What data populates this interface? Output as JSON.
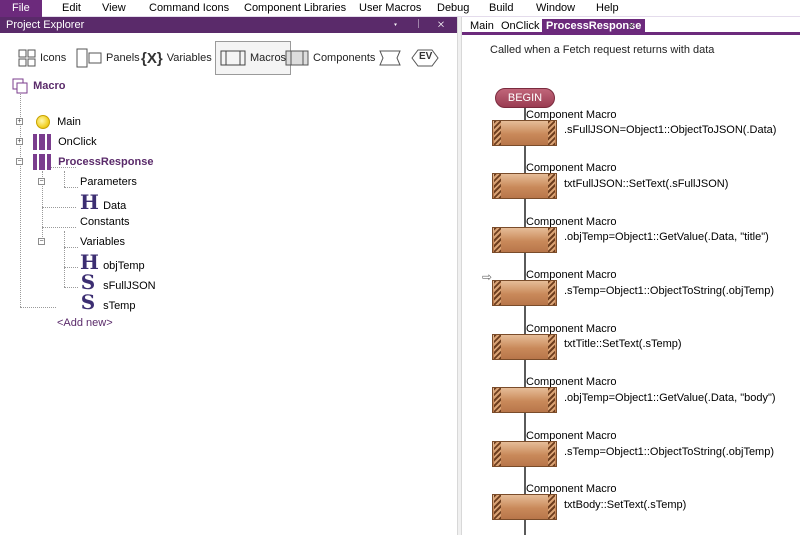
{
  "menu": [
    "File",
    "Edit",
    "View",
    "Command Icons",
    "Component Libraries",
    "User Macros",
    "Debug",
    "Build",
    "Window",
    "Help"
  ],
  "explorer": {
    "title": "Project Explorer",
    "controls": "▾ ᛁ ✕",
    "toolbar": {
      "icons": "Icons",
      "panels": "Panels",
      "variables": "Variables",
      "variables_glyph": "{X}",
      "macros": "Macros",
      "components": "Components",
      "ev": "EV"
    },
    "tree": {
      "root": "Macro",
      "main": "Main",
      "onclick": "OnClick",
      "process": "ProcessResponse",
      "parameters": "Parameters",
      "data": "Data",
      "constants": "Constants",
      "variables": "Variables",
      "objtemp": "objTemp",
      "sfulljson": "sFullJSON",
      "stemp": "sTemp",
      "add_new": "<Add new>",
      "glyph_h": "H",
      "glyph_s": "S"
    }
  },
  "editor": {
    "tabs": [
      "Main",
      "OnClick",
      "ProcessResponse"
    ],
    "close": "×",
    "description": "Called when a Fetch request returns with data",
    "begin": "BEGIN",
    "marker": "⇨",
    "blocks": [
      {
        "title": "Component Macro",
        "code": ".sFullJSON=Object1::ObjectToJSON(.Data)"
      },
      {
        "title": "Component Macro",
        "code": "txtFullJSON::SetText(.sFullJSON)"
      },
      {
        "title": "Component Macro",
        "code": ".objTemp=Object1::GetValue(.Data, \"title\")"
      },
      {
        "title": "Component Macro",
        "code": ".sTemp=Object1::ObjectToString(.objTemp)"
      },
      {
        "title": "Component Macro",
        "code": "txtTitle::SetText(.sTemp)"
      },
      {
        "title": "Component Macro",
        "code": ".objTemp=Object1::GetValue(.Data, \"body\")"
      },
      {
        "title": "Component Macro",
        "code": ".sTemp=Object1::ObjectToString(.objTemp)"
      },
      {
        "title": "Component Macro",
        "code": "txtBody::SetText(.sTemp)"
      }
    ]
  },
  "colors": {
    "accent": "#6c2a7c",
    "block": "#c9895a",
    "begin": "#9b3c52"
  }
}
